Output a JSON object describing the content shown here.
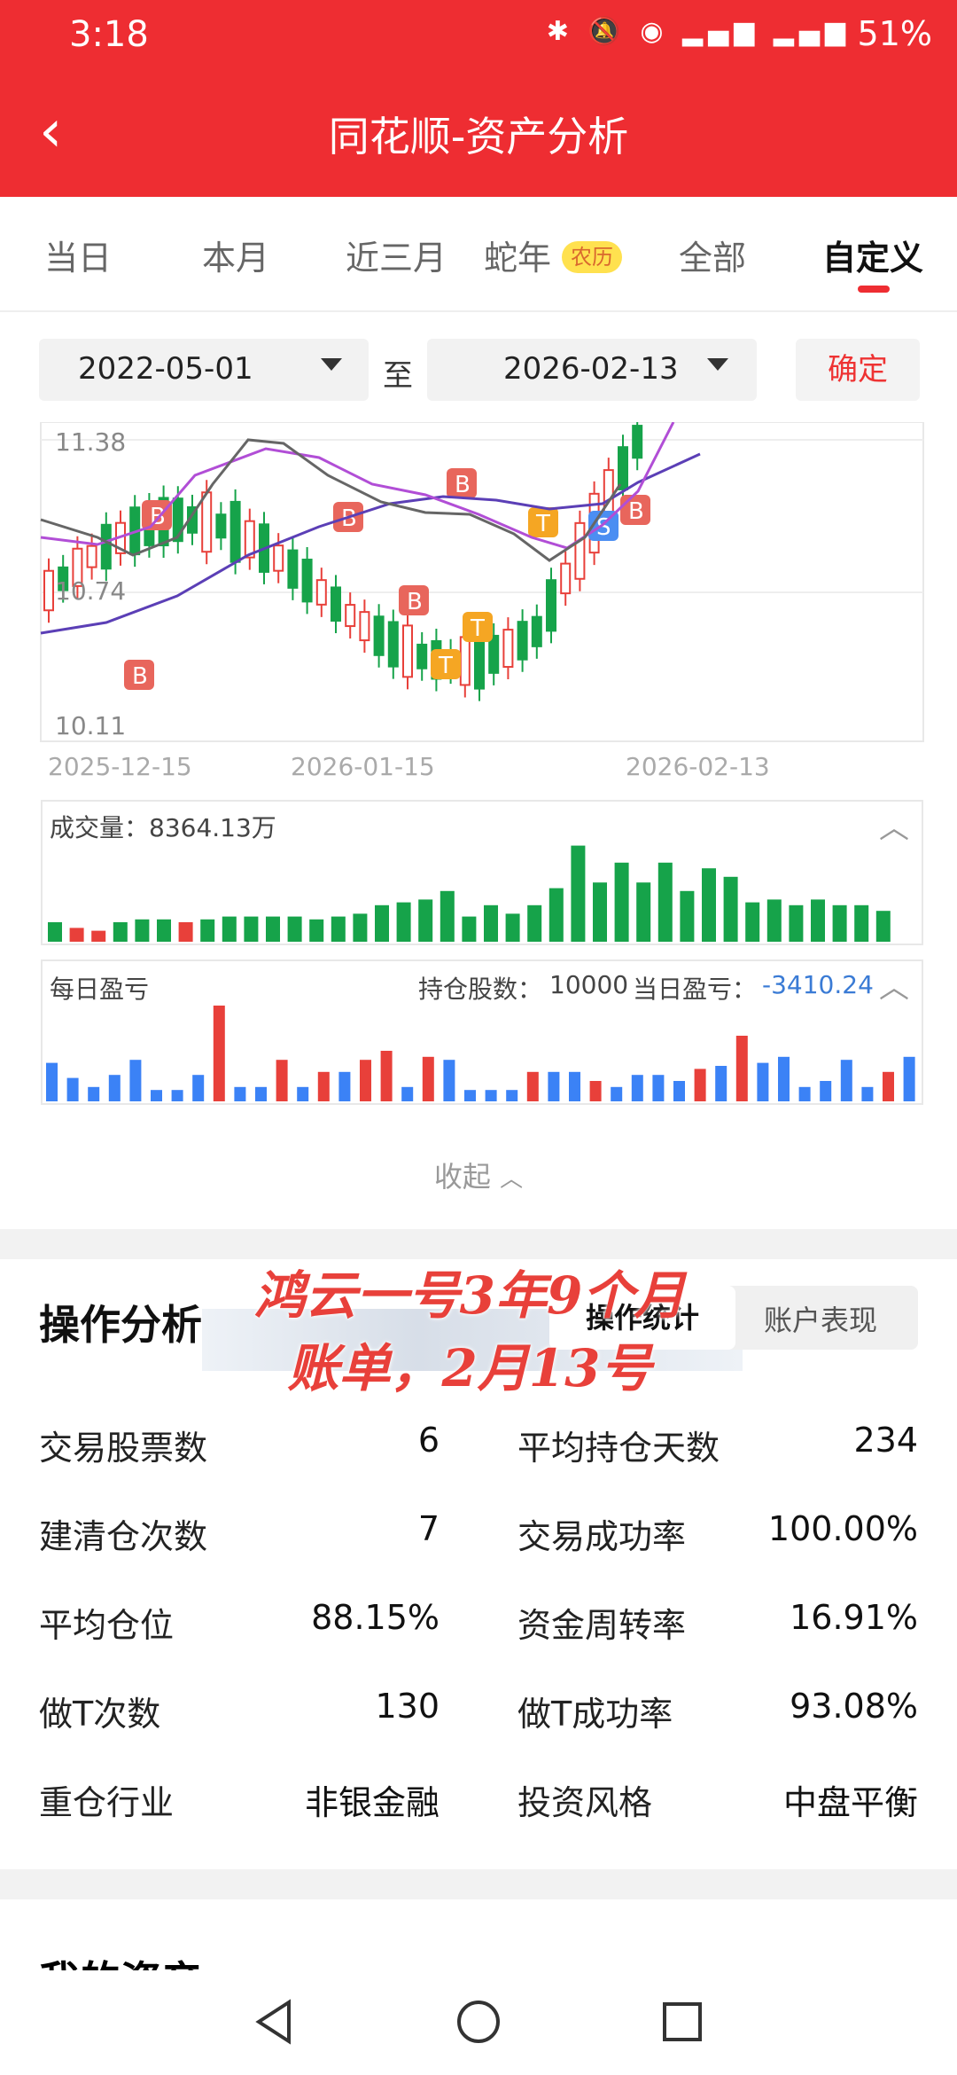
{
  "status": {
    "time": "3:18",
    "battery": "51%"
  },
  "header": {
    "title": "同花顺-资产分析"
  },
  "tabs": [
    {
      "label": "当日"
    },
    {
      "label": "本月"
    },
    {
      "label": "近三月"
    },
    {
      "label": "蛇年",
      "badge": "农历"
    },
    {
      "label": "全部"
    },
    {
      "label": "自定义"
    }
  ],
  "date_range": {
    "start": "2022-05-01",
    "to": "至",
    "end": "2026-02-13",
    "confirm": "确定"
  },
  "kline": {
    "y_labels": [
      "11.38",
      "10.74",
      "10.11"
    ],
    "x_labels": [
      "2025-12-15",
      "2026-01-15",
      "2026-02-13"
    ]
  },
  "volume": {
    "title": "成交量：8364.13万"
  },
  "pnl": {
    "title": "每日盈亏",
    "hold_label": "持仓股数：",
    "hold_value": "10000",
    "day_label": "当日盈亏：",
    "day_value": "-3410.24"
  },
  "collapse": {
    "label": "收起"
  },
  "ops": {
    "title": "操作分析",
    "overlay_line1": "鸿云一号3年9个月",
    "overlay_line2": "账单，2月13号",
    "tab_stats": "操作统计",
    "tab_account": "账户表现",
    "rows": [
      {
        "l1": "交易股票数",
        "v1": "6",
        "l2": "平均持仓天数",
        "v2": "234"
      },
      {
        "l1": "建清仓次数",
        "v1": "7",
        "l2": "交易成功率",
        "v2": "100.00%"
      },
      {
        "l1": "平均仓位",
        "v1": "88.15%",
        "l2": "资金周转率",
        "v2": "16.91%"
      },
      {
        "l1": "做T次数",
        "v1": "130",
        "l2": "做T成功率",
        "v2": "93.08%"
      },
      {
        "l1": "重仓行业",
        "v1": "非银金融",
        "l2": "投资风格",
        "v2": "中盘平衡"
      }
    ]
  },
  "my_assets": {
    "title": "我的资产"
  },
  "colors": {
    "red": "#ee2d32",
    "up": "#e8403a",
    "down": "#16a34a",
    "blue": "#3b82f6",
    "orange": "#f5a623"
  },
  "chart_data": [
    {
      "type": "bar",
      "title": "成交量：8364.13万",
      "values": [
        1,
        -0.6,
        -0.4,
        1,
        1.2,
        1.2,
        -1,
        1.2,
        1.4,
        1.4,
        1.4,
        1.4,
        1.2,
        1.4,
        1.6,
        2.2,
        2.4,
        2.6,
        3.2,
        1.4,
        2.2,
        1.6,
        2.2,
        3.4,
        6.4,
        3.8,
        5.2,
        3.8,
        5.2,
        3.2,
        4.8,
        4.2,
        2.4,
        2.6,
        2.2,
        2.6,
        2.2,
        2.2,
        1.8
      ],
      "units": "relative"
    },
    {
      "type": "bar",
      "title": "每日盈亏",
      "values": [
        -2.2,
        -1.2,
        -0.6,
        -1.4,
        -2.4,
        -0.4,
        -0.4,
        -1.4,
        6,
        -0.6,
        -0.6,
        2.4,
        -0.6,
        1.6,
        -1.6,
        2.4,
        3,
        -0.6,
        2.6,
        -2.4,
        -0.4,
        -0.4,
        -0.4,
        1.6,
        -1.6,
        -1.6,
        1,
        -0.6,
        -1.4,
        -1.4,
        -1,
        1.8,
        -2,
        4,
        -2.2,
        -2.6,
        -0.6,
        -1,
        -2.4,
        -0.6,
        1.6,
        -2.6
      ],
      "units": "relative"
    }
  ]
}
